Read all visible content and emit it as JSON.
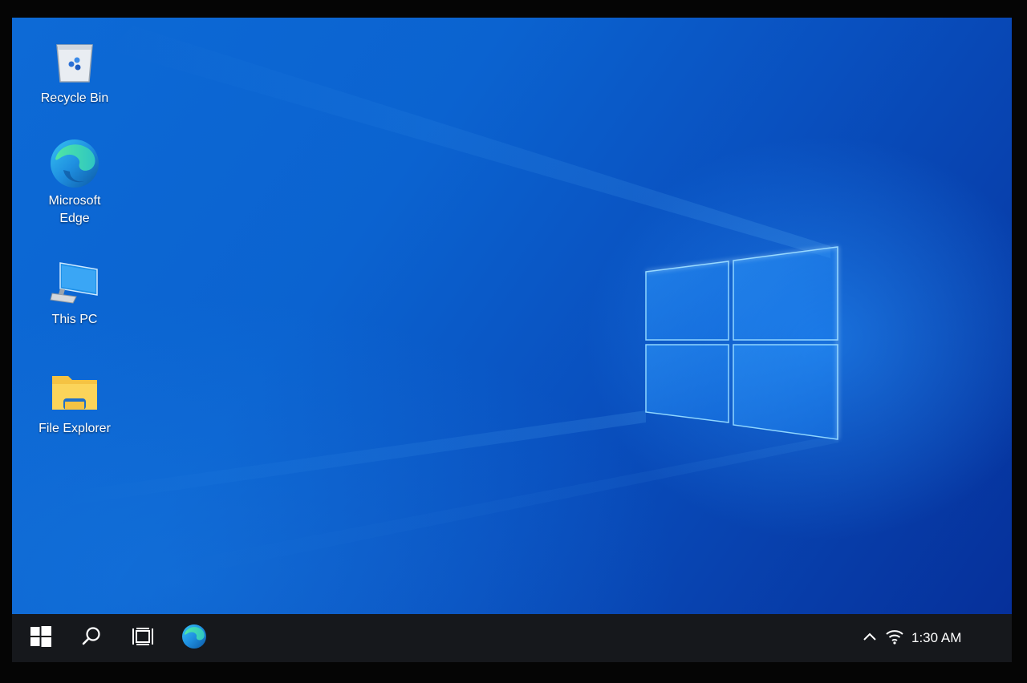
{
  "desktop": {
    "icons": [
      {
        "label": "Recycle Bin",
        "icon": "recycle-bin-icon"
      },
      {
        "label": "Microsoft Edge",
        "icon": "edge-icon"
      },
      {
        "label": "This PC",
        "icon": "computer-icon"
      },
      {
        "label": "File Explorer",
        "icon": "folder-icon"
      }
    ],
    "wallpaper": {
      "name": "windows-logo-light",
      "accent": "#0b63d0"
    }
  },
  "taskbar": {
    "buttons": [
      {
        "icon": "windows-start-icon"
      },
      {
        "icon": "search-icon"
      },
      {
        "icon": "task-view-icon"
      },
      {
        "icon": "edge-icon"
      }
    ],
    "tray": {
      "chevron_icon": "chevron-up-icon",
      "network_icon": "wifi-icon",
      "clock": "1:30 AM"
    },
    "background": "#16181c"
  }
}
